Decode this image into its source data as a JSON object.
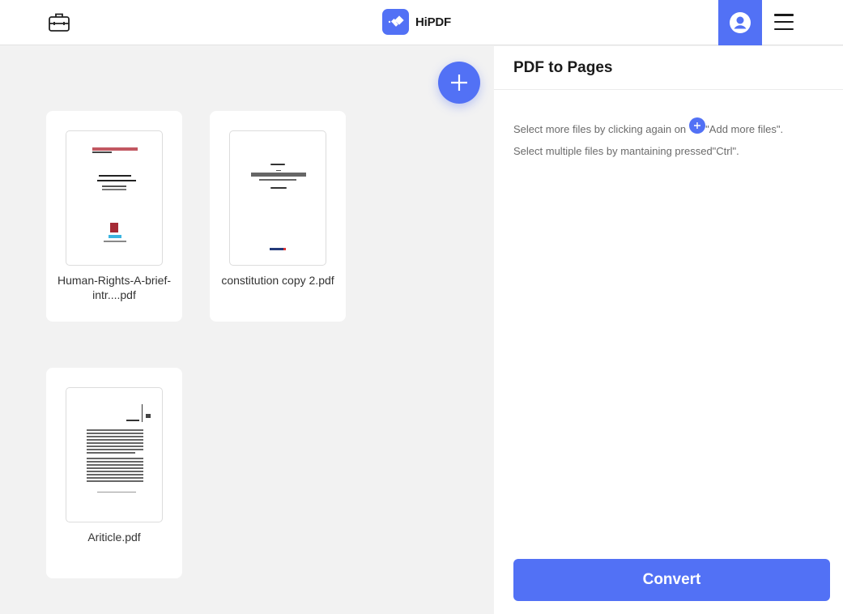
{
  "header": {
    "tools_icon": "briefcase-icon",
    "logo_text": "HiPDF",
    "user_icon": "user-icon",
    "menu_icon": "hamburger-menu-icon"
  },
  "workspace": {
    "add_button_icon": "plus-icon",
    "files": [
      {
        "name": "Human-Rights-A-brief-intr....pdf",
        "thumb_title": "Human Rights: A Brief Introduction"
      },
      {
        "name": "constitution copy 2.pdf",
        "thumb_title": "THE CONSTITUTION"
      },
      {
        "name": "Ariticle.pdf",
        "thumb_title": "Introduction"
      }
    ]
  },
  "panel": {
    "title": "PDF to Pages",
    "hint1_before": "Select more files by clicking again on",
    "hint1_after": "\"Add more files\".",
    "hint2": "Select multiple files by mantaining pressed\"Ctrl\".",
    "convert_label": "Convert"
  },
  "colors": {
    "accent": "#5271f5",
    "background": "#f2f2f2"
  }
}
